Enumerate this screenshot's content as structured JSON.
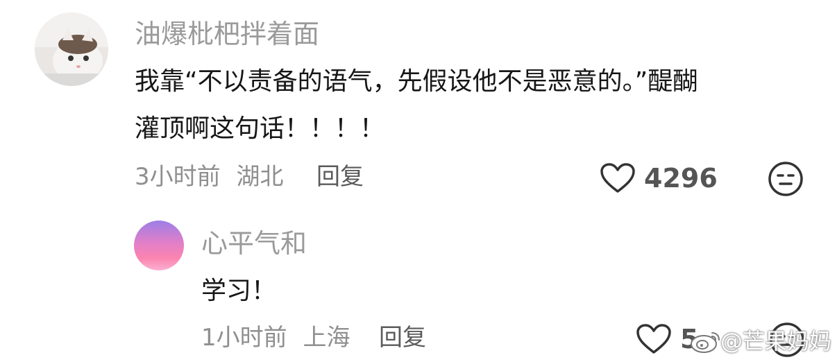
{
  "comment": {
    "username": "油爆枇杷拌着面",
    "text_line1": "我靠“不以责备的语气，先假设他不是恶意的。”醍醐",
    "text_line2": "灌顶啊这句话！！！！",
    "time": "3小时前",
    "location": "湖北",
    "reply_label": "回复",
    "likes": "4296",
    "avatar_icon": "cat-avatar-icon",
    "like_icon": "heart-outline-icon",
    "emoji_icon": "neutral-face-icon"
  },
  "reply": {
    "username": "心平气和",
    "text": "学习！",
    "time": "1小时前",
    "location": "上海",
    "reply_label": "回复",
    "likes": "5",
    "avatar_icon": "pink-gradient-avatar-icon",
    "like_icon": "heart-outline-icon",
    "emoji_icon": "neutral-face-icon"
  },
  "watermark": {
    "text": "@芒果妈妈",
    "icon": "weibo-icon"
  },
  "colors": {
    "username": "#9a9a9a",
    "body_text": "#161616",
    "meta_text": "#8f8f8f"
  }
}
